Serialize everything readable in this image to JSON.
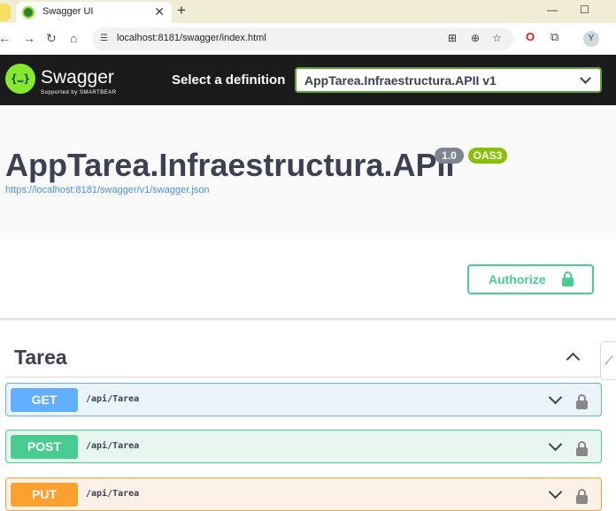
{
  "browser": {
    "tab_title": "Swagger UI",
    "tab_close": "✕",
    "new_tab": "+",
    "minimize": "—",
    "maximize": "☐",
    "url": "localhost:8181/swagger/index.html",
    "profile_initial": "Y"
  },
  "swagger": {
    "brand": "Swagger",
    "brand_sub": "Supported by SMARTBEAR",
    "select_label": "Select a definition",
    "selected_definition": "AppTarea.Infraestructura.APII v1"
  },
  "info": {
    "title": "AppTarea.Infraestructura.APII",
    "version": "1.0",
    "oas": "OAS3",
    "spec_url": "https://localhost:8181/swagger/v1/swagger.json"
  },
  "auth": {
    "authorize_label": "Authorize"
  },
  "tag": {
    "name": "Tarea"
  },
  "operations": [
    {
      "method": "GET",
      "path": "/api/Tarea"
    },
    {
      "method": "POST",
      "path": "/api/Tarea"
    },
    {
      "method": "PUT",
      "path": "/api/Tarea"
    }
  ],
  "colors": {
    "get": "#61affe",
    "post": "#49cc90",
    "put": "#fca130",
    "swagger_green": "#85ea2d"
  }
}
